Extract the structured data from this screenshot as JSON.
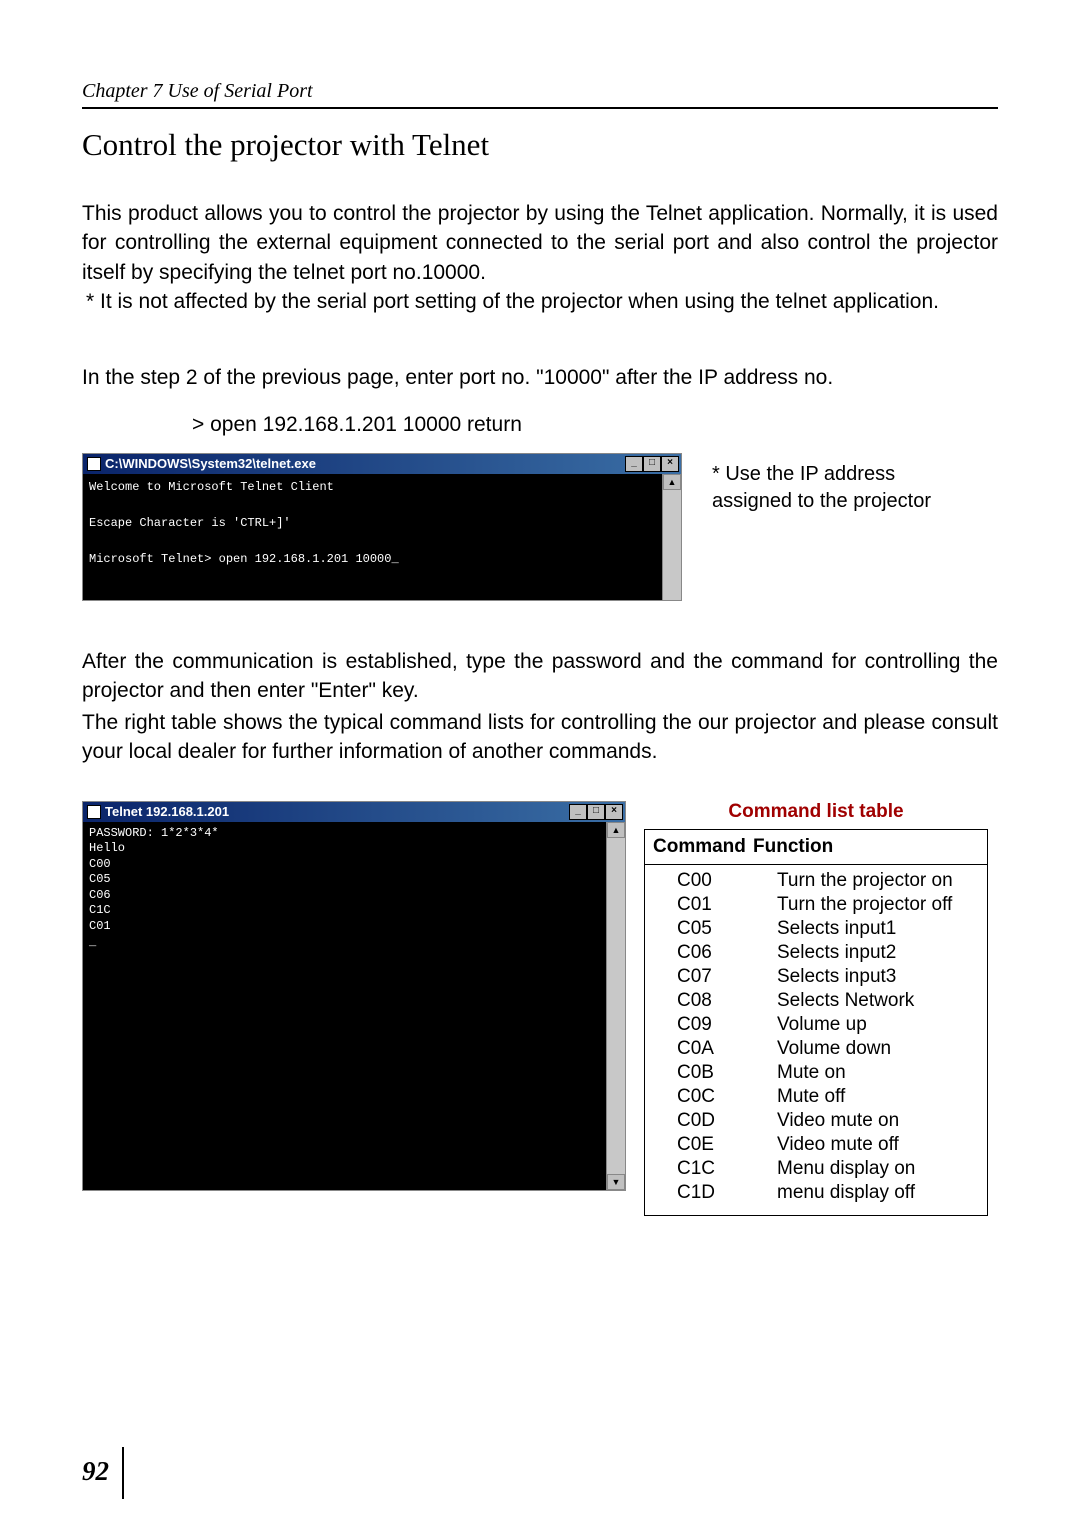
{
  "header": {
    "chapter": "Chapter 7 Use of Serial Port"
  },
  "section": {
    "title": "Control the projector with Telnet"
  },
  "intro": {
    "p1": "This product allows you to control the projector by using the Telnet application. Normally, it is used for controlling the external equipment connected to the serial port and also control the projector itself by specifying the telnet port no.10000.",
    "note": "* It is not affected by the serial port setting of the projector when using the telnet application.",
    "step": "In the step 2 of the previous page, enter port no. \"10000\" after the IP address no.",
    "step_cmd": "> open 192.168.1.201 10000 return"
  },
  "term1": {
    "title": "C:\\WINDOWS\\System32\\telnet.exe",
    "line1": "Welcome to Microsoft Telnet Client",
    "line2": "Escape Character is 'CTRL+]'",
    "line3": "Microsoft Telnet> open 192.168.1.201 10000_"
  },
  "side_note1": "* Use the IP address assigned to the projector",
  "after": {
    "p1": "After the communication is established, type the password and the command for controlling the projector and then enter \"Enter\" key.",
    "p2": "The right table shows the typical command lists for controlling the our projector and please consult your local dealer for further information of another commands."
  },
  "term2": {
    "title": "Telnet 192.168.1.201",
    "body": "PASSWORD: 1*2*3*4*\nHello\nC00\nC05\nC06\nC1C\nC01\n_"
  },
  "cmd_table": {
    "title": "Command list table",
    "head_cmd": "Command",
    "head_func": "Function",
    "rows": [
      {
        "cmd": "C00",
        "func": "Turn the projector on"
      },
      {
        "cmd": "C01",
        "func": "Turn the projector off"
      },
      {
        "cmd": "C05",
        "func": "Selects input1"
      },
      {
        "cmd": "C06",
        "func": "Selects input2"
      },
      {
        "cmd": "C07",
        "func": "Selects input3"
      },
      {
        "cmd": "C08",
        "func": "Selects Network"
      },
      {
        "cmd": "C09",
        "func": "Volume up"
      },
      {
        "cmd": "C0A",
        "func": "Volume down"
      },
      {
        "cmd": "C0B",
        "func": "Mute on"
      },
      {
        "cmd": "C0C",
        "func": "Mute off"
      },
      {
        "cmd": "C0D",
        "func": "Video mute on"
      },
      {
        "cmd": "C0E",
        "func": "Video mute off"
      },
      {
        "cmd": "C1C",
        "func": "Menu display on"
      },
      {
        "cmd": "C1D",
        "func": "menu display off"
      }
    ]
  },
  "page_number": "92"
}
